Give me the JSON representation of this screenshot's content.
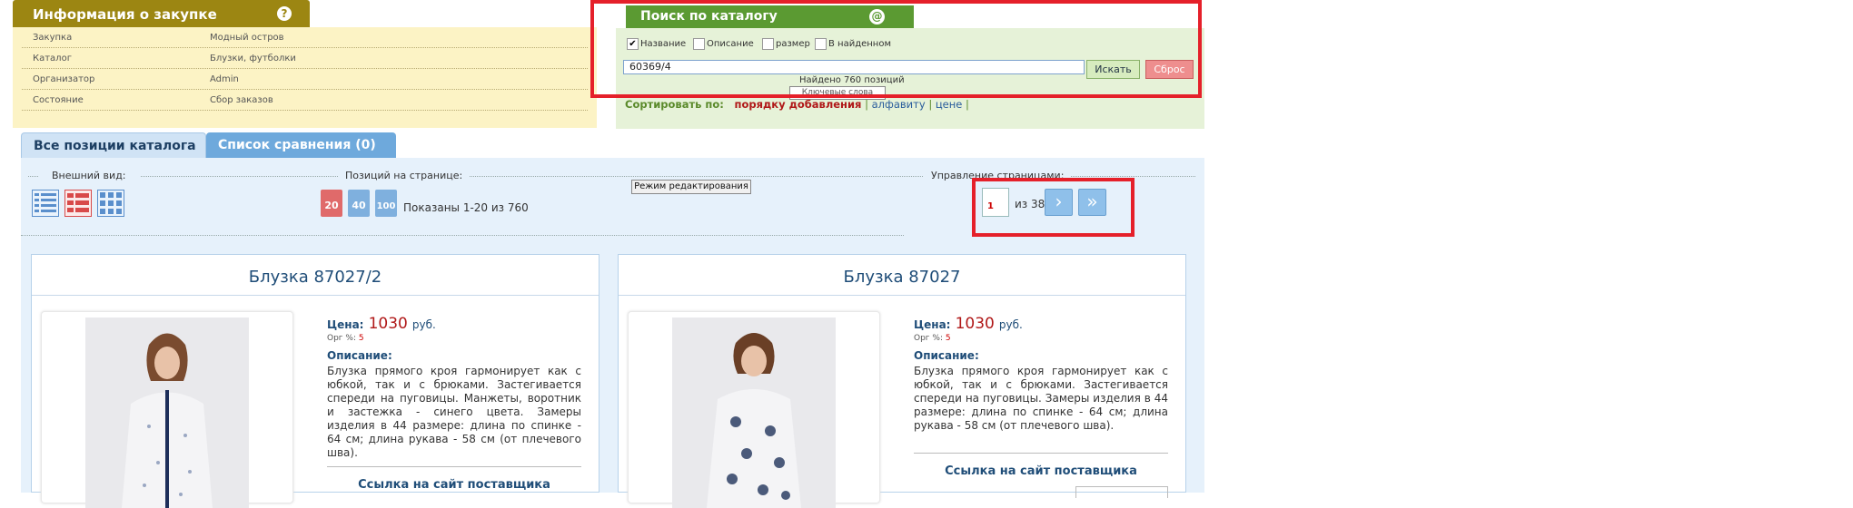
{
  "info": {
    "title": "Информация о закупке",
    "rows": [
      {
        "key": "Закупка",
        "value": "Модный остров"
      },
      {
        "key": "Каталог",
        "value": "Блузки, футболки"
      },
      {
        "key": "Организатор",
        "value": "Admin"
      },
      {
        "key": "Состояние",
        "value": "Сбор заказов"
      }
    ]
  },
  "search": {
    "title": "Поиск по каталогу",
    "checkboxes": [
      {
        "label": "Название",
        "checked": true
      },
      {
        "label": "Описание",
        "checked": false
      },
      {
        "label": "размер",
        "checked": false
      },
      {
        "label": "В найденном",
        "checked": false
      }
    ],
    "query": "60369/4",
    "search_button": "Искать",
    "reset_button": "Сброс",
    "found_text": "Найдено 760 позиций",
    "tooltip": "Ключевые слова"
  },
  "sort": {
    "label": "Сортировать по:",
    "current": "порядку добавления",
    "alphabet": "алфавиту",
    "price": "цене"
  },
  "tabs": {
    "all": "Все позиции каталога",
    "compare": "Список сравнения (0)"
  },
  "toolbar": {
    "view_label": "Внешний вид:",
    "per_page_label": "Позиций на странице:",
    "per_page_options": [
      "20",
      "40",
      "100"
    ],
    "shown_text": "Показаны 1-20 из 760",
    "edit_mode": "Режим редактирования",
    "paging_label": "Управление страницами:",
    "page": "1",
    "of_text": "из 38"
  },
  "products": [
    {
      "title": "Блузка 87027/2",
      "price_label": "Цена:",
      "price": "1030",
      "currency": "руб.",
      "org_label": "Орг %:",
      "org_value": "5",
      "desc_label": "Описание:",
      "description": "Блузка прямого кроя гармонирует как с юбкой, так и с брюками. Застегивается спереди на пуговицы. Манжеты, воротник и застежка - синего цвета. Замеры изделия в 44 размере: длина по спинке - 64 см; длина рукава - 58 см (от плечевого шва).",
      "supplier_link": "Ссылка на сайт поставщика"
    },
    {
      "title": "Блузка 87027",
      "price_label": "Цена:",
      "price": "1030",
      "currency": "руб.",
      "org_label": "Орг %:",
      "org_value": "5",
      "desc_label": "Описание:",
      "description": "Блузка прямого кроя гармонирует как с юбкой, так и с брюками. Застегивается спереди на пуговицы. Замеры изделия в 44 размере: длина по спинке - 64 см; длина рукава - 58 см (от плечевого шва).",
      "supplier_link": "Ссылка на сайт поставщика"
    }
  ],
  "colors": {
    "info_header": "#9c8612",
    "search_header": "#5b9a32",
    "price": "#b01818",
    "highlight_frame": "#e5202a"
  }
}
